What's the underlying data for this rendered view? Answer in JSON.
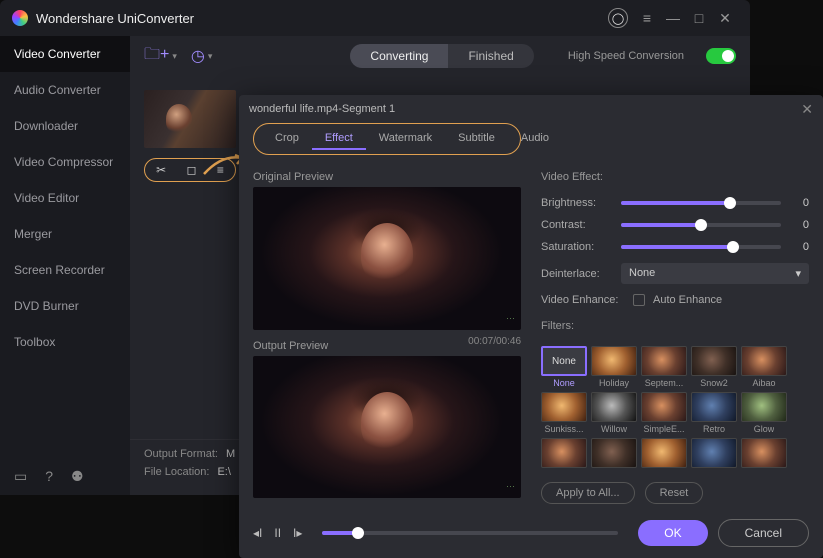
{
  "app": {
    "title": "Wondershare UniConverter"
  },
  "titlebar_icons": {
    "menu": "≡",
    "min": "—",
    "max": "□",
    "close": "✕",
    "avatar": "◯"
  },
  "sidebar": {
    "items": [
      {
        "label": "Video Converter",
        "active": true
      },
      {
        "label": "Audio Converter"
      },
      {
        "label": "Downloader"
      },
      {
        "label": "Video Compressor"
      },
      {
        "label": "Video Editor"
      },
      {
        "label": "Merger"
      },
      {
        "label": "Screen Recorder"
      },
      {
        "label": "DVD Burner"
      },
      {
        "label": "Toolbox"
      }
    ]
  },
  "toolbar": {
    "tabs": [
      {
        "label": "Converting",
        "active": true
      },
      {
        "label": "Finished"
      }
    ],
    "hs_label": "High Speed Conversion"
  },
  "file": {
    "name": "wonderful life.mp4"
  },
  "output": {
    "format_label": "Output Format:",
    "format_value": "M",
    "location_label": "File Location:",
    "location_value": "E:\\"
  },
  "panel": {
    "segment_title": "wonderful life.mp4-Segment 1",
    "tabs": [
      "Crop",
      "Effect",
      "Watermark",
      "Subtitle",
      "Audio"
    ],
    "active_tab": "Effect",
    "original_label": "Original Preview",
    "output_label": "Output Preview",
    "time_cur": "00:07",
    "time_total": "00:46",
    "time_combined": "00:07/00:46",
    "effect": {
      "section": "Video Effect:",
      "brightness_label": "Brightness:",
      "brightness": 0,
      "brightness_pct": 68,
      "contrast_label": "Contrast:",
      "contrast": 0,
      "contrast_pct": 50,
      "saturation_label": "Saturation:",
      "saturation": 0,
      "saturation_pct": 70,
      "deinterlace_label": "Deinterlace:",
      "deinterlace_value": "None",
      "enhance_label": "Video Enhance:",
      "auto_enhance": "Auto Enhance",
      "filters_label": "Filters:"
    },
    "filters_row1": [
      {
        "name": "None",
        "sel": true,
        "cls": "f-none"
      },
      {
        "name": "Holiday",
        "cls": "f-warm"
      },
      {
        "name": "Septem...",
        "cls": "f-img"
      },
      {
        "name": "Snow2",
        "cls": "f-dark"
      },
      {
        "name": "Aibao",
        "cls": "f-img"
      }
    ],
    "filters_row2": [
      {
        "name": "Sunkiss...",
        "cls": "f-warm"
      },
      {
        "name": "Willow",
        "cls": "f-bw"
      },
      {
        "name": "SimpleE...",
        "cls": "f-img"
      },
      {
        "name": "Retro",
        "cls": "f-blue"
      },
      {
        "name": "Glow",
        "cls": "f-green"
      }
    ],
    "filters_row3": [
      {
        "name": "",
        "cls": "f-img"
      },
      {
        "name": "",
        "cls": "f-dark"
      },
      {
        "name": "",
        "cls": "f-warm"
      },
      {
        "name": "",
        "cls": "f-blue"
      },
      {
        "name": "",
        "cls": "f-img"
      }
    ],
    "apply_all": "Apply to All...",
    "reset": "Reset",
    "ok": "OK",
    "cancel": "Cancel"
  }
}
